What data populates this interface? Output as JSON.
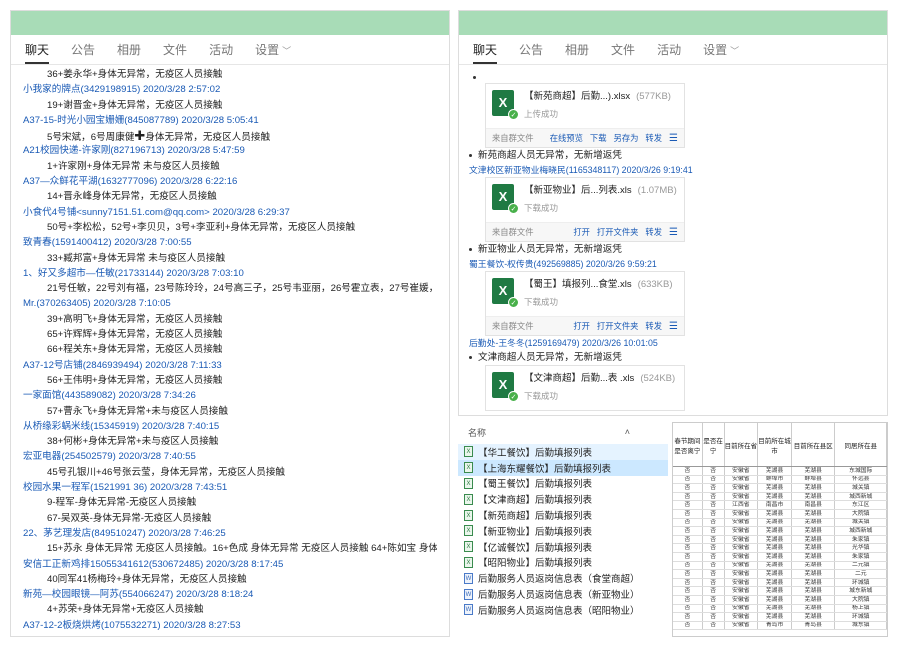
{
  "left_panel": {
    "tabs": [
      {
        "label": "聊天",
        "active": true
      },
      {
        "label": "公告",
        "active": false
      },
      {
        "label": "相册",
        "active": false
      },
      {
        "label": "文件",
        "active": false
      },
      {
        "label": "活动",
        "active": false
      },
      {
        "label": "设置",
        "active": false,
        "dropdown": true
      }
    ],
    "messages": [
      {
        "type": "body",
        "text": "36+姜永华+身体无异常，无疫区人员接触"
      },
      {
        "type": "sender",
        "text": "小我家的牌点(3429198915) 2020/3/28 2:57:02"
      },
      {
        "type": "body",
        "text": "19+谢晋金+身体无异常，无疫区人员接触"
      },
      {
        "type": "sender",
        "text": "A37-15-时光小园宝姗姗(845087789) 2020/3/28 5:05:41"
      },
      {
        "type": "body_cross",
        "text_before": "5号宋斌，6号周康健",
        "text_cross": "✚",
        "text_after": "身体无异常，无疫区人员接触"
      },
      {
        "type": "sender",
        "text": "A21校园快递-许家刚(827196713) 2020/3/28 5:47:59"
      },
      {
        "type": "body",
        "text": "1+许家刚+身体无异常 未与疫区人员接触"
      },
      {
        "type": "sender",
        "text": "A37—众鲜花平湖(1632777096) 2020/3/28 6:22:16"
      },
      {
        "type": "body",
        "text": "14+晋永峰身体无异常，无疫区人员接触"
      },
      {
        "type": "sender",
        "text": "小食代4号铺<sunny7151.51.com@qq.com> 2020/3/28 6:29:37"
      },
      {
        "type": "body",
        "text": "50号+李松松，52号+李贝贝，3号+李亚利+身体无异常，无疫区人员接触"
      },
      {
        "type": "sender",
        "text": "致青春(1591400412) 2020/3/28 7:00:55"
      },
      {
        "type": "body",
        "text": "33+臧邦富+身体无异常 未与疫区人员接触"
      },
      {
        "type": "sender",
        "text": "1、好又多超市—任敏(21733144) 2020/3/28 7:03:10"
      },
      {
        "type": "body",
        "text": "   21号任敏，22号刘有福，23号陈玲玲，24号高三子，25号韦亚丽，26号霍立表，27号崔媛，28号同环，"
      },
      {
        "type": "sender",
        "text": "Mr.(370263405) 2020/3/28 7:10:05"
      },
      {
        "type": "body",
        "text": "39+高明飞+身体无异常，无疫区人员接触"
      },
      {
        "type": "body",
        "text": "65+许辉辉+身体无异常，无疫区人员接触"
      },
      {
        "type": "body",
        "text": "66+程关东+身体无异常，无疫区人员接触"
      },
      {
        "type": "sender",
        "text": "A37-12号店铺(2846939494) 2020/3/28 7:11:33"
      },
      {
        "type": "body",
        "text": "56+王伟明+身体无异常，无疫区人员接触"
      },
      {
        "type": "sender",
        "text": "一家面馆(443589082) 2020/3/28 7:34:26"
      },
      {
        "type": "body",
        "text": "57+曹永飞+身体无异常+未与疫区人员接触"
      },
      {
        "type": "sender",
        "text": "从桥缘彩蜗米线(15345919) 2020/3/28 7:40:15"
      },
      {
        "type": "body",
        "text": "38+何彬+身体无异常+未与疫区人员接触"
      },
      {
        "type": "sender",
        "text": "宏亚电器(254502579) 2020/3/28 7:40:55"
      },
      {
        "type": "body",
        "text": "45号孔银川+46号张云莹，身体无异常，无疫区人员接触"
      },
      {
        "type": "sender",
        "text": "校园水果一程军(1521991 36) 2020/3/28 7:43:51"
      },
      {
        "type": "body",
        "text": "9-程军-身体无异常-无疫区人员接触"
      },
      {
        "type": "body",
        "text": "67-吴双英-身体无异常-无疫区人员接触"
      },
      {
        "type": "sender",
        "text": "22、茅艺理发店(849510247) 2020/3/28 7:46:25"
      },
      {
        "type": "body",
        "text": "15+苏永 身体无异常  无疫区人员接触。16+色成  身体无异常  无疫区人员接触     64+陈如宝 身体无"
      },
      {
        "type": "sender",
        "text": "安信工正新鸡排15055341612(530672485) 2020/3/28 8:17:45"
      },
      {
        "type": "body",
        "text": "40同军41杨梅玲+身体无异常，无疫区人员接触"
      },
      {
        "type": "sender",
        "text": "新苑—校园眼镜—阿苏(554066247) 2020/3/28 8:18:24"
      },
      {
        "type": "body",
        "text": "4+苏荣+身体无异常+无疫区人员接触"
      },
      {
        "type": "sender",
        "text": "A37-12-2板烧烘烤(1075532271) 2020/3/28 8:27:53"
      }
    ]
  },
  "right_panel": {
    "tabs": [
      {
        "label": "聊天",
        "active": true
      },
      {
        "label": "公告",
        "active": false
      },
      {
        "label": "相册",
        "active": false
      },
      {
        "label": "文件",
        "active": false
      },
      {
        "label": "活动",
        "active": false
      },
      {
        "label": "设置",
        "active": false,
        "dropdown": true
      }
    ],
    "file_cards": [
      {
        "name": "【新苑商超】后勤...).xlsx",
        "size": "(577KB)",
        "status": "上传成功",
        "source": "来自群文件",
        "actions": [
          "在线预览",
          "下载",
          "另存为",
          "转发"
        ]
      },
      {
        "name": "【新亚物业】后...列表.xls",
        "size": "(1.07MB)",
        "status": "下载成功",
        "source": "来自群文件",
        "actions": [
          "打开",
          "打开文件夹",
          "转发"
        ]
      },
      {
        "name": "【蜀王】填报列...食堂.xls",
        "size": "(633KB)",
        "status": "下载成功",
        "source": "来自群文件",
        "actions": [
          "打开",
          "打开文件夹",
          "转发"
        ]
      },
      {
        "name": "【文津商超】后勤...表 .xls",
        "size": "(524KB)",
        "status": "下载成功"
      }
    ],
    "notes": [
      "新苑商超人员无异常，无新增返凭",
      "新亚物业人员无异常，无新增返凭",
      "文津商超人员无异常，无新增返凭"
    ],
    "senders": [
      "文津校区新亚物业梅晓民(1165348117) 2020/3/26 9:19:41",
      "蜀王餐饮-权传贵(492569885) 2020/3/26 9:59:21",
      "后勤处-王冬冬(1259169479) 2020/3/26 10:01:05"
    ]
  },
  "explorer": {
    "header": "名称",
    "files": [
      {
        "name": "【华工餐饮】后勤填报列表",
        "kind": "xls",
        "state": "normal"
      },
      {
        "name": "【上海东耀餐饮】后勤填报列表",
        "kind": "xls",
        "state": "selected"
      },
      {
        "name": "【蜀王餐饮】后勤填报列表",
        "kind": "xls",
        "state": "normal"
      },
      {
        "name": "【文津商超】后勤填报列表",
        "kind": "xls",
        "state": "normal"
      },
      {
        "name": "【新苑商超】后勤填报列表",
        "kind": "xls",
        "state": "normal"
      },
      {
        "name": "【新亚物业】后勤填报列表",
        "kind": "xls",
        "state": "normal"
      },
      {
        "name": "【亿诚餐饮】后勤填报列表",
        "kind": "xls",
        "state": "normal"
      },
      {
        "name": "【昭阳物业】后勤填报列表",
        "kind": "xls",
        "state": "normal"
      },
      {
        "name": "后勤服务人员返岗信息表（食堂商超）",
        "kind": "doc",
        "state": "normal"
      },
      {
        "name": "后勤服务人员返岗信息表（新亚物业）",
        "kind": "doc",
        "state": "normal"
      },
      {
        "name": "后勤服务人员返岗信息表（昭阳物业）",
        "kind": "doc",
        "state": "normal"
      }
    ]
  },
  "spreadsheet": {
    "headers": [
      "春节期间是否离宁",
      "是否在宁",
      "目前所在省",
      "目前所在城市",
      "目前所在县区",
      "同居所在县"
    ],
    "rows": [
      [
        "否",
        "否",
        "安徽省",
        "芜湖县",
        "芜湖县",
        "东城国际"
      ],
      [
        "否",
        "否",
        "安徽省",
        "蚌埠市",
        "蚌埠县",
        "怀远县"
      ],
      [
        "否",
        "否",
        "安徽省",
        "芜湖县",
        "芜湖县",
        "城关镇"
      ],
      [
        "否",
        "否",
        "安徽省",
        "芜湖县",
        "芜湖县",
        "城西新城"
      ],
      [
        "否",
        "否",
        "江西省",
        "南昌市",
        "南昌县",
        "东江区"
      ],
      [
        "否",
        "否",
        "安徽省",
        "芜湖县",
        "芜湖县",
        "大院镇"
      ],
      [
        "否",
        "否",
        "安徽省",
        "芜湖县",
        "芜湖县",
        "城关镇"
      ],
      [
        "否",
        "否",
        "安徽省",
        "芜湖县",
        "芜湖县",
        "城西新城"
      ],
      [
        "否",
        "否",
        "安徽省",
        "芜湖县",
        "芜湖县",
        "朱家镇"
      ],
      [
        "否",
        "否",
        "安徽省",
        "芜湖县",
        "芜湖县",
        "光华镇"
      ],
      [
        "否",
        "否",
        "安徽省",
        "芜湖县",
        "芜湖县",
        "朱家镇"
      ],
      [
        "否",
        "否",
        "安徽省",
        "芜湖县",
        "芜湖县",
        "二元镇"
      ],
      [
        "否",
        "否",
        "安徽省",
        "芜湖县",
        "芜湖县",
        "二元"
      ],
      [
        "否",
        "否",
        "安徽省",
        "芜湖县",
        "芜湖县",
        "环城镇"
      ],
      [
        "否",
        "否",
        "安徽省",
        "芜湖县",
        "芜湖县",
        "城东新城"
      ],
      [
        "否",
        "否",
        "安徽省",
        "芜湖县",
        "芜湖县",
        "大院镇"
      ],
      [
        "否",
        "否",
        "安徽省",
        "芜湖县",
        "芜湖县",
        "杨上镇"
      ],
      [
        "否",
        "否",
        "安徽省",
        "芜湖县",
        "芜湖县",
        "环城镇"
      ],
      [
        "否",
        "否",
        "安徽省",
        "青岛市",
        "青岛县",
        "城东镇"
      ]
    ]
  }
}
